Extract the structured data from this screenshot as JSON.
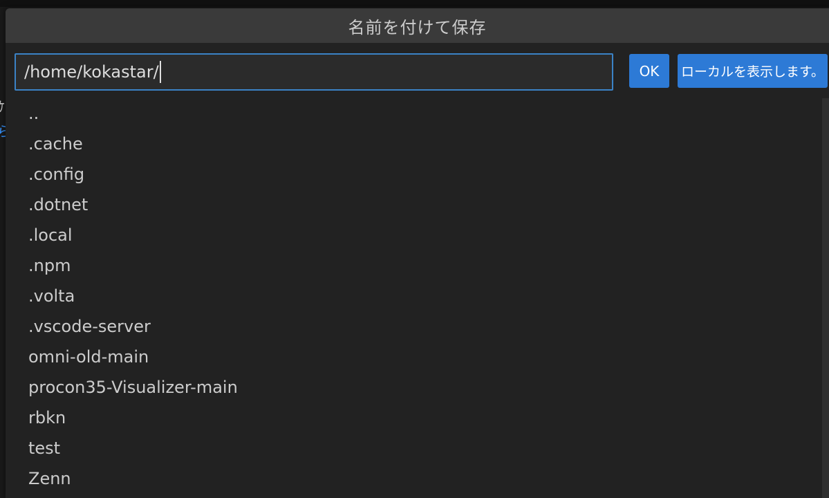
{
  "dialog": {
    "title": "名前を付けて保存",
    "path_value": "/home/kokastar/",
    "ok_label": "OK",
    "show_local_label": "ローカルを表示します。"
  },
  "files": [
    {
      "name": ".."
    },
    {
      "name": ".cache"
    },
    {
      "name": ".config"
    },
    {
      "name": ".dotnet"
    },
    {
      "name": ".local"
    },
    {
      "name": ".npm"
    },
    {
      "name": ".volta"
    },
    {
      "name": ".vscode-server"
    },
    {
      "name": "omni-old-main"
    },
    {
      "name": "procon35-Visualizer-main"
    },
    {
      "name": "rbkn"
    },
    {
      "name": "test"
    },
    {
      "name": "Zenn"
    }
  ],
  "colors": {
    "accent": "#2d7ad6",
    "focus_border": "#3b83c7",
    "dialog_bg": "#222222",
    "titlebar_bg": "#3a3a3a",
    "text": "#cccccc"
  }
}
